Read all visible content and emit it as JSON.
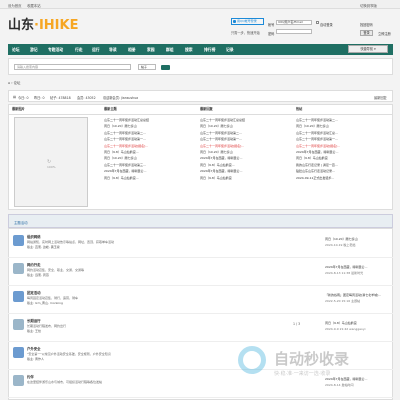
{
  "topbar": {
    "items": [
      "设为首页",
      "收藏本站"
    ],
    "right": "切换到窄版"
  },
  "logo": {
    "part1": "山东",
    "part2": "·IHIKE"
  },
  "qq": {
    "label": "用QQ帐号登录",
    "sub": "只需一步，快速开始"
  },
  "login": {
    "user_label": "帐号",
    "user_value": "UID/用户名/Email",
    "remember": "自动登录",
    "forgot": "找回密码",
    "pass_label": "密码",
    "button": "登录",
    "register": "立即注册"
  },
  "nav": {
    "items": [
      "论坛",
      "游记",
      "专题活动",
      "行走",
      "运行",
      "导读",
      "相册",
      "家园",
      "群组",
      "搜索",
      "排行榜",
      "记录"
    ],
    "dropdown": "快捷导航"
  },
  "search": {
    "placeholder": "请输入搜索内容",
    "type": "帖子"
  },
  "breadcrumb": "论坛",
  "info": {
    "today": "今日: 0",
    "yesterday": "昨日: 0",
    "posts": "帖子: 478818",
    "members": "会员: 43052",
    "newest": "欢迎新会员: jiansushua",
    "right": "最新回复"
  },
  "panel": {
    "heads": [
      "最新图片",
      "最新主题",
      "最新回复",
      "热帖"
    ],
    "img_pct": "100%",
    "col2": [
      {
        "t": "山东二十一周年徒步活动汇总总结",
        "r": false
      },
      {
        "t": "周日（10.20）腾七泰山",
        "r": false
      },
      {
        "t": "山东二十一周年徒步活动第二...",
        "r": false
      },
      {
        "t": "山东二十一周年徒步活动第一...",
        "r": false
      },
      {
        "t": "山东二十一周年徒步活动[报名]...",
        "r": true
      },
      {
        "t": "周日（9.8）马山仙鹤宫...",
        "r": false
      },
      {
        "t": "周日（10.20）腾七泰山",
        "r": false
      },
      {
        "t": "山东二十一周年徒步活动第三...",
        "r": false
      },
      {
        "t": "2024年7月在西藏，喀喇昆仑...",
        "r": false
      },
      {
        "t": "周日（9.8）马山仙鹤宫...",
        "r": false
      }
    ],
    "col3": [
      {
        "t": "山东二十一周年徒步活动汇总总结",
        "r": false
      },
      {
        "t": "周日（10.20）腾七泰山",
        "r": false
      },
      {
        "t": "山东二十一周年徒步活动第二...",
        "r": false
      },
      {
        "t": "山东二十一周年徒步活动第一...",
        "r": false
      },
      {
        "t": "山东二十一周年徒步活动[报名]...",
        "r": true
      },
      {
        "t": "周日（10.20）腾七泰山",
        "r": false
      },
      {
        "t": "2024年7月在西藏，喀喇昆仑...",
        "r": false
      },
      {
        "t": "周日（9.8）马山仙鹤宫...",
        "r": false
      },
      {
        "t": "2024年7月在西藏，喀喇昆仑...",
        "r": false
      },
      {
        "t": "周日（9.8）马山仙鹤宫",
        "r": false
      }
    ],
    "col4": [
      {
        "t": "山东二十一周年徒步活动第二...",
        "r": false
      },
      {
        "t": "周日（10.20）腾七泰山",
        "r": false
      },
      {
        "t": "山东二十一周年徒步活动汇总...",
        "r": false
      },
      {
        "t": "山东二十一周年徒步活动第一...",
        "r": false
      },
      {
        "t": "山东二十一周年徒步活动[报名]...",
        "r": true
      },
      {
        "t": "2024年7月在西藏，喀喇昆仑...",
        "r": false
      },
      {
        "t": "周日（9.8）马山仙鹤宫",
        "r": false
      },
      {
        "t": "我的山东行走记录 | 满足一百...",
        "r": false
      },
      {
        "t": "贴肚山东山东行走活动记录...",
        "r": false
      },
      {
        "t": "2024-09-11正式出发徒步...",
        "r": false
      }
    ]
  },
  "section": {
    "title": "主题活动"
  },
  "forums": [
    {
      "title": "组织网络",
      "desc": "网站通知、实时网上活动告示等站点，网址、置顶、获取单车活动",
      "mod": "版主: 直而, 边峰, 黑玉瓷",
      "stats": "",
      "l1": "周日（10.20）腾七泰山",
      "l2": "2024-10-19 晚上老拙",
      "l1b": false
    },
    {
      "title": "网约行走",
      "desc": "网约活动召集，安全、职业、交通、交通等",
      "mod": "版主: 远而, 周燕",
      "stats": "",
      "l1": "2024年7月在西藏，喀喇昆仑...",
      "l2": "2024-8-13 11:38 最新时光",
      "l1b": false
    },
    {
      "title": "团定活动",
      "desc": "每周固定活动召集，骑行，露营，骑车",
      "mod": "版主: lxm_黄山, monking",
      "stats": "",
      "l1": "「新的谷雨」团定每周活动[满七北羊城]...",
      "l2": "2022-5-20 15:16 主题帖",
      "l1b": false
    },
    {
      "title": "长期运行",
      "desc": "长期活动行程发布，网约出行",
      "mod": "版主: 王炫",
      "stats": "1 / 3",
      "l1": "周日（9.8）马山仙鹤宫",
      "l2": "2024-9-9 21:42 wanggaoyi",
      "l1b": false
    },
    {
      "title": "户外安全",
      "desc": "\"安全第一\"以常见户外活动安全基础，安全规则，户外安全知识",
      "mod": "版主: 黄作人",
      "stats": "",
      "l1": "",
      "l2": "",
      "l1b": false
    },
    {
      "title": "约伴",
      "desc": "在这里结伴游乐山水与城市，可组织活动行程等各位发帖",
      "mod": "",
      "stats": "",
      "l1": "2024年7月在西藏，喀喇昆仑...",
      "l2": "2024-8-14 发帖时间",
      "l1b": false
    }
  ],
  "watermark": {
    "title": "自动秒收录",
    "sub": "快·稳·准·一来访一选·收录"
  }
}
